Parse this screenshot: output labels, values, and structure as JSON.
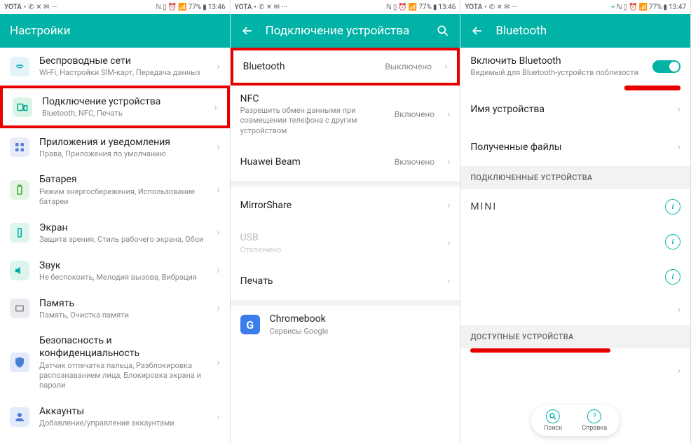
{
  "status": {
    "carrier": "YOTA",
    "battery": "77%",
    "time1": "13:46",
    "time2": "13:46",
    "time3": "13:47"
  },
  "screen1": {
    "title": "Настройки",
    "items": [
      {
        "title": "Беспроводные сети",
        "sub": "Wi-Fi, Настройки SIM-карт, Передача данных"
      },
      {
        "title": "Подключение устройства",
        "sub": "Bluetooth, NFC, Печать"
      },
      {
        "title": "Приложения и уведомления",
        "sub": "Права, Приложения по умолчанию"
      },
      {
        "title": "Батарея",
        "sub": "Режим энергосбережения, Использование батареи"
      },
      {
        "title": "Экран",
        "sub": "Защита зрения, Стиль рабочего экрана, Обои"
      },
      {
        "title": "Звук",
        "sub": "Не беспокоить, Мелодия вызова, Вибрация"
      },
      {
        "title": "Память",
        "sub": "Память, Очистка памяти"
      },
      {
        "title": "Безопасность и конфиденциальность",
        "sub": "Датчик отпечатка пальца, Разблокировка распознаванием лица, Блокировка экрана и пароли"
      },
      {
        "title": "Аккаунты",
        "sub": "Добавление/управление аккаунтами"
      }
    ]
  },
  "screen2": {
    "title": "Подключение устройства",
    "items": [
      {
        "title": "Bluetooth",
        "value": "Выключено"
      },
      {
        "title": "NFC",
        "sub": "Разрешить обмен данными при совмещении телефона с другим устройством",
        "value": "Включено"
      },
      {
        "title": "Huawei Beam",
        "value": "Включено"
      },
      {
        "title": "MirrorShare"
      },
      {
        "title": "USB",
        "sub": "Отключено"
      },
      {
        "title": "Печать"
      },
      {
        "title": "Chromebook",
        "sub": "Сервисы Google"
      }
    ]
  },
  "screen3": {
    "title": "Bluetooth",
    "enable_title": "Включить Bluetooth",
    "enable_sub": "Видимый для Bluetooth-устройств поблизости",
    "device_name_label": "Имя устройства",
    "received_files_label": "Полученные файлы",
    "section_connected": "ПОДКЛЮЧЕННЫЕ УСТРОЙСТВА",
    "section_available": "ДОСТУПНЫЕ УСТРОЙСТВА",
    "device1": "MINI",
    "fab_search": "Поиск",
    "fab_help": "Справка"
  }
}
